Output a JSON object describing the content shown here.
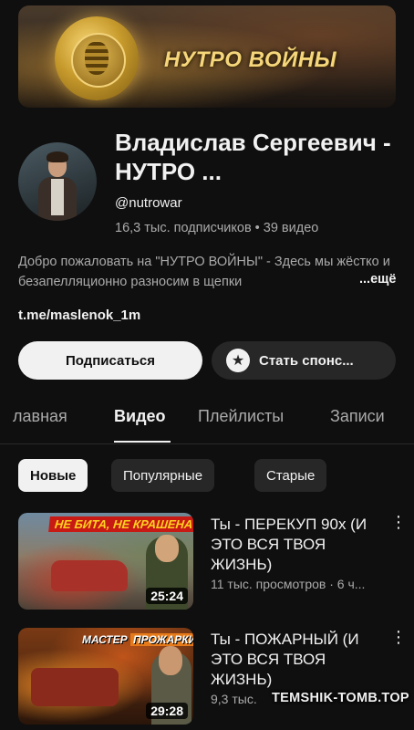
{
  "banner": {
    "title": "НУТРО ВОЙНЫ"
  },
  "channel": {
    "name": "Владислав Сергеевич - НУТРО ...",
    "handle": "@nutrowar",
    "stats": "16,3 тыс. подписчиков • 39 видео",
    "description": "Добро пожаловать на \"НУТРО ВОЙНЫ\" - Здесь мы жёстко и безапелляционно разносим в щепки",
    "more_label": "...ещё",
    "link": "t.me/maslenok_1m"
  },
  "buttons": {
    "subscribe": "Подписаться",
    "sponsor": "Стать спонс...",
    "sponsor_icon": "star-icon"
  },
  "tabs": [
    {
      "label": "лавная",
      "active": false
    },
    {
      "label": "Видео",
      "active": true
    },
    {
      "label": "Плейлисты",
      "active": false
    },
    {
      "label": "Записи",
      "active": false
    }
  ],
  "chips": [
    {
      "label": "Новые",
      "active": true
    },
    {
      "label": "Популярные",
      "active": false
    },
    {
      "label": "Старые",
      "active": false
    }
  ],
  "videos": [
    {
      "thumb_text": "НЕ БИТА, НЕ КРАШЕНА",
      "duration": "25:24",
      "title": "Ты - ПЕРЕКУП 90х (И ЭТО ВСЯ ТВОЯ ЖИЗНЬ)",
      "meta": "11 тыс. просмотров · 6 ч..."
    },
    {
      "thumb_text_a": "МАСТЕР",
      "thumb_text_b": "ПРОЖАРКИ",
      "duration": "29:28",
      "title": "Ты - ПОЖАРНЫЙ (И ЭТО ВСЯ ТВОЯ ЖИЗНЬ)",
      "meta": "9,3 тыс."
    }
  ],
  "watermark": "TEMSHIK-TOMB.TOP",
  "colors": {
    "background": "#0f0f0f",
    "text_primary": "#f1f1f1",
    "text_secondary": "#aaaaaa",
    "chip_bg": "#272727"
  }
}
